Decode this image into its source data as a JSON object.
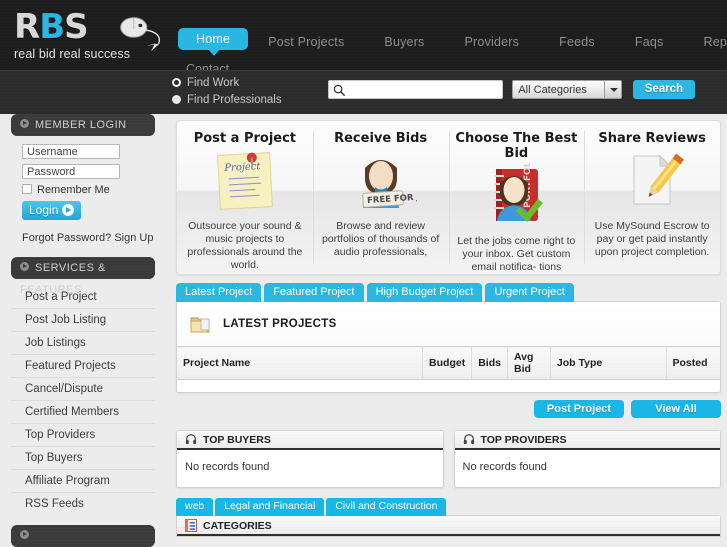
{
  "brand": {
    "logo_r": "R",
    "logo_b": "B",
    "logo_s": "S",
    "tagline": "real bid real success",
    "accent": "#29b6e0",
    "header_bg": "#1d1d1d"
  },
  "nav": {
    "items": [
      {
        "label": "Home",
        "active": true
      },
      {
        "label": "Post Projects",
        "active": false
      },
      {
        "label": "Buyers",
        "active": false
      },
      {
        "label": "Providers",
        "active": false
      },
      {
        "label": "Feeds",
        "active": false
      },
      {
        "label": "Faqs",
        "active": false
      },
      {
        "label": "Reports",
        "active": false
      }
    ],
    "contact": "Contact"
  },
  "search": {
    "radio_find_work": "Find Work",
    "radio_find_professionals": "Find Professionals",
    "input_value": "",
    "input_placeholder": "",
    "category_selected": "All Categories",
    "button_label": "Search"
  },
  "sidebar": {
    "login_panel_title": "MEMBER LOGIN",
    "username_value": "Username",
    "password_value": "Password",
    "remember_label": "Remember Me",
    "login_button": "Login",
    "forgot_text": "Forgot Password? Sign Up",
    "services_panel_title": "SERVICES & FEATURES",
    "services": [
      "Post a Project",
      "Post Job Listing",
      "Job Listings",
      "Featured Projects",
      "Cancel/Dispute",
      "Certified Members",
      "Top Providers",
      "Top Buyers",
      "Affiliate Program",
      "RSS Feeds"
    ]
  },
  "features": [
    {
      "title": "Post a Project",
      "icon": "sticky-note-icon",
      "text": "Outsource your sound & music projects to professionals around the world."
    },
    {
      "title": "Receive Bids",
      "icon": "person-free-for-job-icon",
      "text": "Browse and review portfolios of thousands of audio professionals,"
    },
    {
      "title": "Choose The Best Bid",
      "icon": "portfolio-checkmark-icon",
      "text": "Let the jobs come right to your inbox. Get custom email notifica- tions"
    },
    {
      "title": "Share Reviews",
      "icon": "pencil-document-icon",
      "text": "Use MySound Escrow to pay or get paid instantly upon project completion."
    }
  ],
  "project_tabs": [
    {
      "label": "Latest Project",
      "active": true
    },
    {
      "label": "Featured Project",
      "active": false
    },
    {
      "label": "High Budget Project",
      "active": false
    },
    {
      "label": "Urgent Project",
      "active": false
    }
  ],
  "latest_projects": {
    "heading": "LATEST PROJECTS",
    "columns": [
      "Project Name",
      "Budget",
      "Bids",
      "Avg Bid",
      "Job Type",
      "Posted"
    ],
    "rows": []
  },
  "project_actions": {
    "post_project": "Post Project",
    "view_all": "View All"
  },
  "top_boxes": [
    {
      "title": "TOP BUYERS",
      "empty_text": "No records found"
    },
    {
      "title": "TOP PROVIDERS",
      "empty_text": "No records found"
    }
  ],
  "category_tabs": [
    {
      "label": "web",
      "active": true
    },
    {
      "label": "Legal and Financial",
      "active": false
    },
    {
      "label": "Civil and Construction",
      "active": false
    }
  ],
  "categories_panel": {
    "title": "CATEGORIES"
  }
}
